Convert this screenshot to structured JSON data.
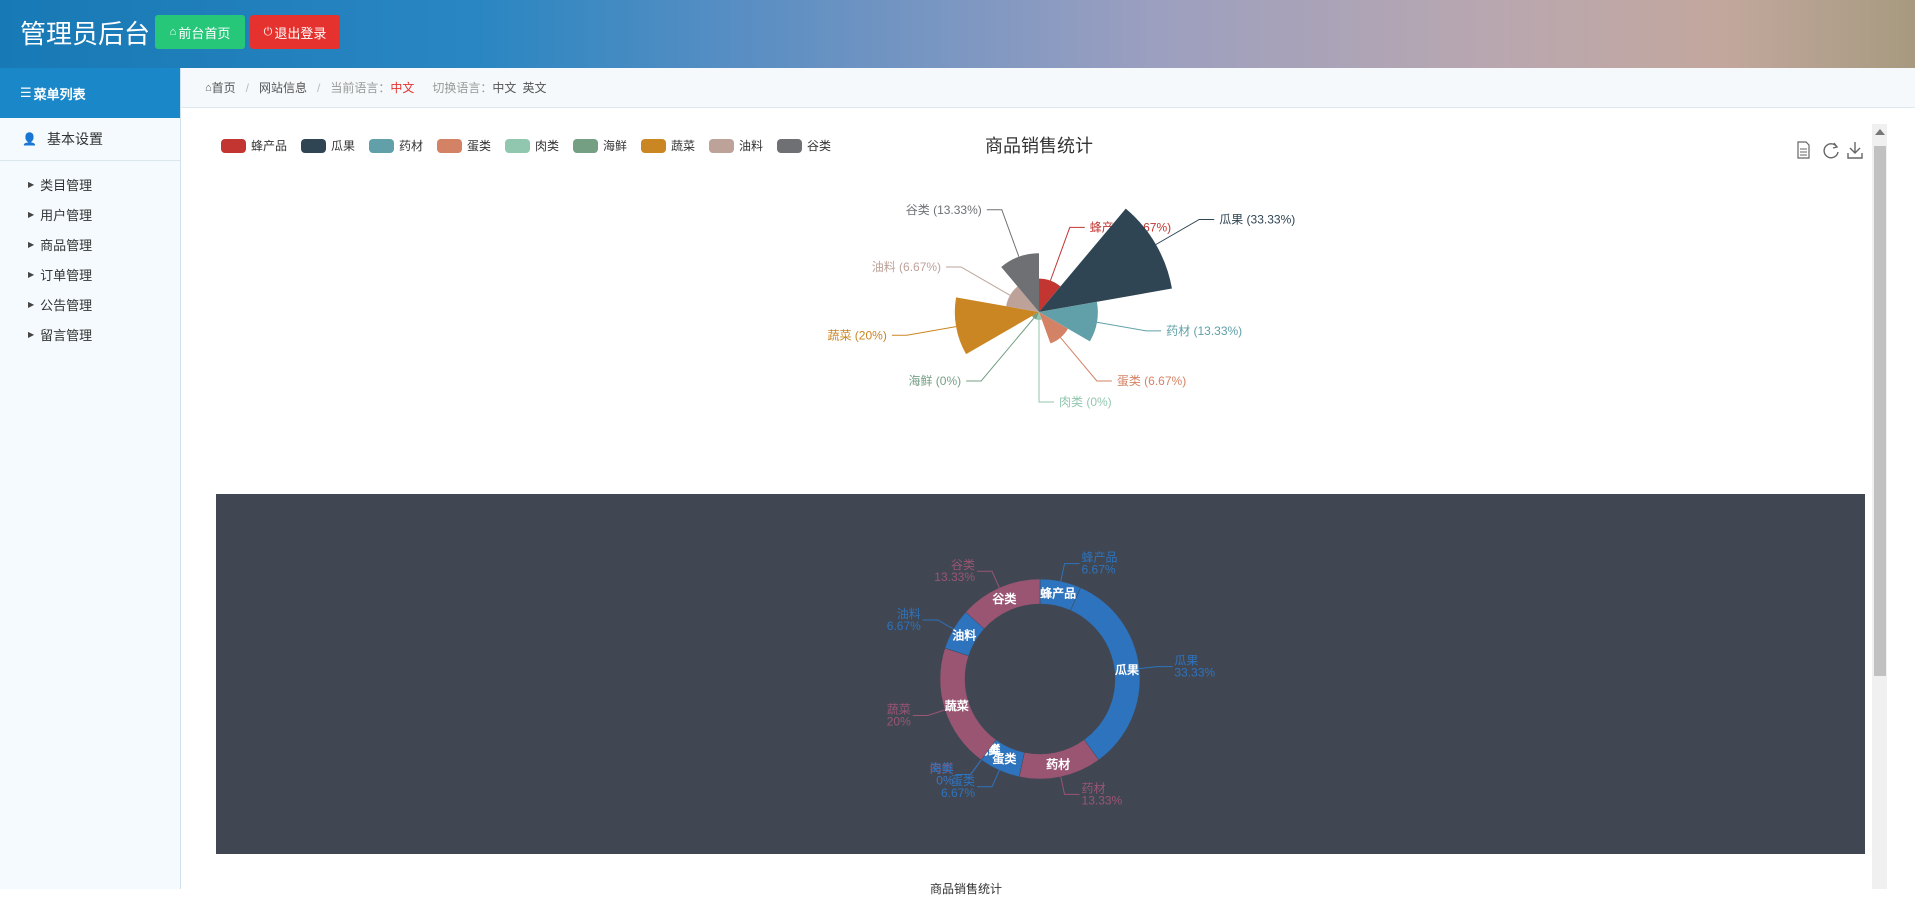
{
  "app": {
    "title": "管理员后台"
  },
  "top": {
    "home_btn": "前台首页",
    "logout_btn": "退出登录"
  },
  "sidebar": {
    "header": "菜单列表",
    "section": "基本设置",
    "items": [
      {
        "label": "类目管理"
      },
      {
        "label": "用户管理"
      },
      {
        "label": "商品管理"
      },
      {
        "label": "订单管理"
      },
      {
        "label": "公告管理"
      },
      {
        "label": "留言管理"
      }
    ]
  },
  "breadcrumb": {
    "home": "首页",
    "site": "网站信息",
    "lang_label": "当前语言：",
    "lang_value": "中文",
    "switch_label": "切换语言：",
    "zh": "中文",
    "en": "英文"
  },
  "icons": {
    "home": "home-icon",
    "logout": "power-icon",
    "menu": "list-icon",
    "user": "user-icon",
    "chevron": "caret-right-icon",
    "save": "document-icon",
    "refresh": "refresh-icon",
    "download": "download-icon"
  },
  "colors": {
    "top_green": "#27c77a",
    "top_red": "#e6322e",
    "sidebar_header": "#1a87c8",
    "dark_panel": "#404753"
  },
  "chart_data": [
    {
      "type": "pie",
      "variant": "rose",
      "title": "商品销售统计",
      "legend_position": "top-left",
      "categories": [
        "蜂产品",
        "瓜果",
        "药材",
        "蛋类",
        "肉类",
        "海鲜",
        "蔬菜",
        "油料",
        "谷类"
      ],
      "values": [
        1,
        5,
        2,
        1,
        0,
        0,
        3,
        1,
        2
      ],
      "labels": [
        "蜂产品 (6.67%)",
        "瓜果 (33.33%)",
        "药材 (13.33%)",
        "蛋类 (6.67%)",
        "肉类 (0%)",
        "海鲜 (0%)",
        "蔬菜 (20%)",
        "油料 (6.67%)",
        "谷类 (13.33%)"
      ],
      "colors": [
        "#c23531",
        "#2f4554",
        "#61a0a8",
        "#d48265",
        "#91c7ae",
        "#749f83",
        "#ca8622",
        "#bda29a",
        "#6e7074"
      ]
    },
    {
      "type": "pie",
      "variant": "donut",
      "categories": [
        "蜂产品",
        "瓜果",
        "药材",
        "蛋类",
        "肉类",
        "海鲜",
        "蔬菜",
        "油料",
        "谷类"
      ],
      "values": [
        1,
        5,
        2,
        1,
        0,
        0,
        3,
        1,
        2
      ],
      "outer_labels": [
        {
          "name": "蜂产品",
          "pct": "6.67%"
        },
        {
          "name": "瓜果",
          "pct": "33.33%"
        },
        {
          "name": "药材",
          "pct": "13.33%"
        },
        {
          "name": "蛋类",
          "pct": "6.67%"
        },
        {
          "name": "肉类",
          "pct": "0%"
        },
        {
          "name": "海鲜",
          "pct": "0%"
        },
        {
          "name": "蔬菜",
          "pct": "20%"
        },
        {
          "name": "油料",
          "pct": "6.67%"
        },
        {
          "name": "谷类",
          "pct": "13.33%"
        }
      ],
      "colors": [
        "#2d73bd",
        "#2d73bd",
        "#9a5573",
        "#2d73bd",
        "#9a5573",
        "#2d73bd",
        "#9a5573",
        "#2d73bd",
        "#9a5573"
      ]
    }
  ],
  "bottom": {
    "title": "商品销售统计"
  }
}
